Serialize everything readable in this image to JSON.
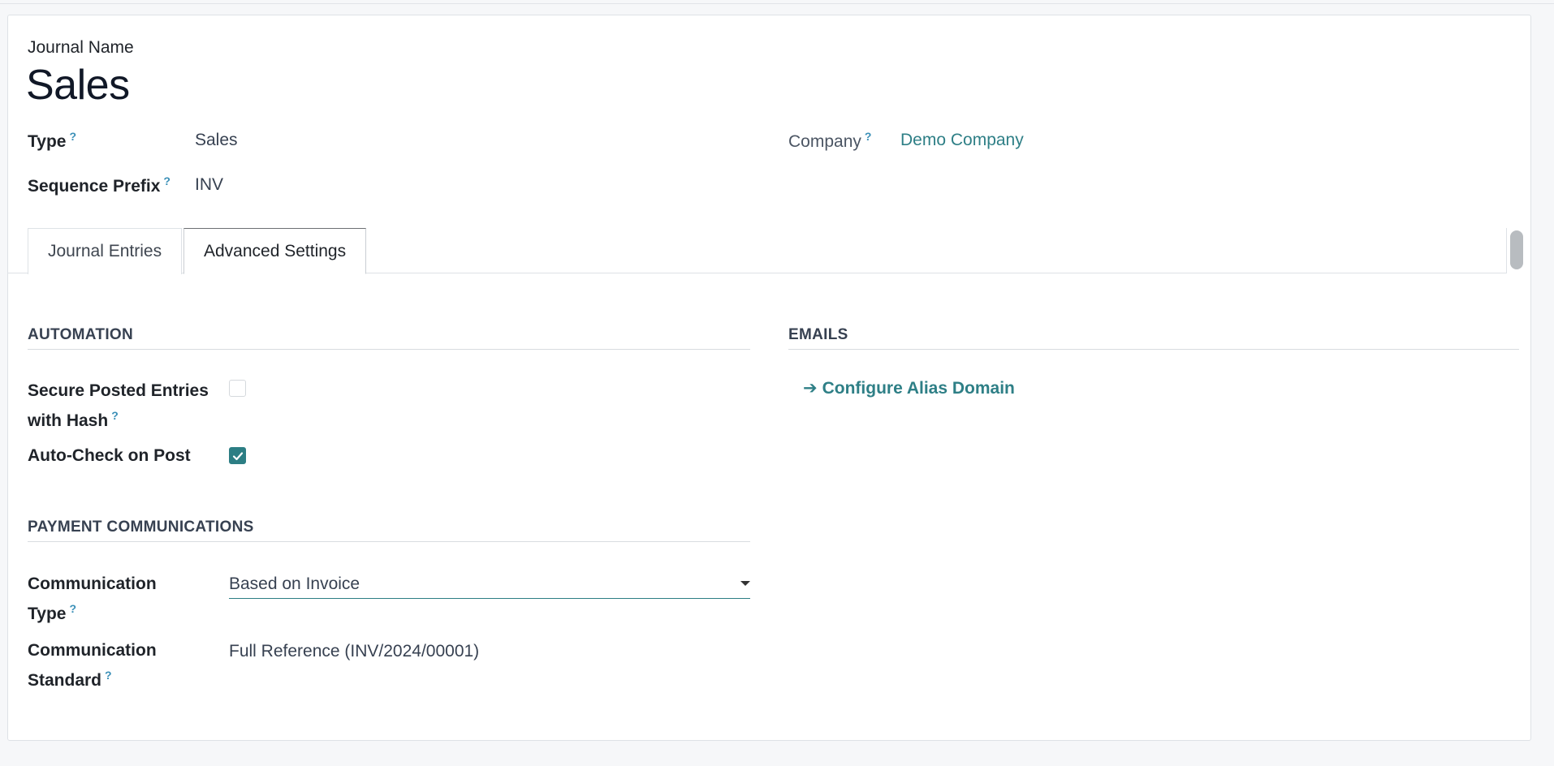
{
  "header": {
    "name_label": "Journal Name",
    "name_value": "Sales"
  },
  "fields": {
    "type_label": "Type",
    "type_value": "Sales",
    "prefix_label": "Sequence Prefix",
    "prefix_value": "INV",
    "company_label": "Company",
    "company_value": "Demo Company",
    "tooltip_mark": "?"
  },
  "tabs": [
    {
      "label": "Journal Entries",
      "active": false
    },
    {
      "label": "Advanced Settings",
      "active": true
    }
  ],
  "automation": {
    "heading": "AUTOMATION",
    "secure_label_line1": "Secure Posted Entries",
    "secure_label_line2": "with Hash",
    "secure_checked": false,
    "autocheck_label": "Auto-Check on Post",
    "autocheck_checked": true
  },
  "emails": {
    "heading": "EMAILS",
    "arrow": "➔",
    "configure_link": "Configure Alias Domain"
  },
  "payment": {
    "heading": "PAYMENT COMMUNICATIONS",
    "comm_type_line1": "Communication",
    "comm_type_line2": "Type",
    "comm_type_value": "Based on Invoice",
    "comm_std_line1": "Communication",
    "comm_std_line2": "Standard",
    "comm_std_value": "Full Reference (INV/2024/00001)"
  },
  "colors": {
    "accent": "#2c7e84",
    "tooltip": "#3a8fb7",
    "background": "#f6f7f9"
  }
}
